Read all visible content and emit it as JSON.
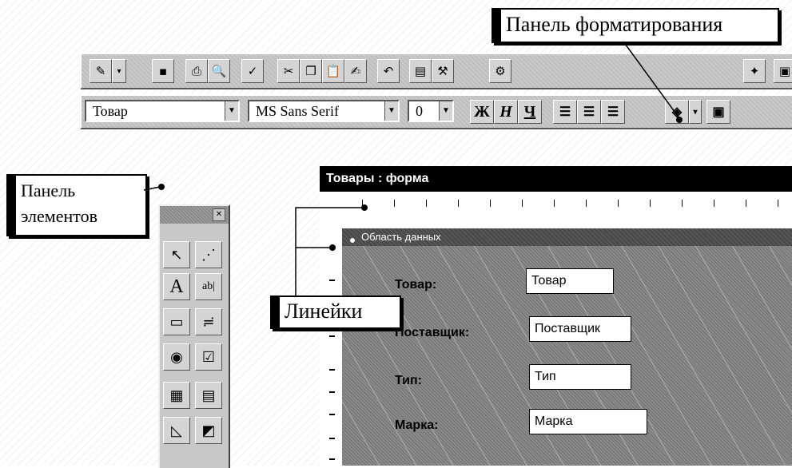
{
  "callouts": {
    "format_panel": "Панель форматирования",
    "toolbox_line1": "Панель",
    "toolbox_line2": "элементов",
    "rulers": "Линейки"
  },
  "format_toolbar": {
    "object_combo": "Товар",
    "font_combo": "MS Sans Serif",
    "size_combo": "0",
    "bold": "Ж",
    "italic": "Н",
    "underline": "Ч"
  },
  "form": {
    "title": "Товары : форма",
    "section": "Область данных",
    "fields": [
      {
        "label": "Товар:",
        "value": "Товар"
      },
      {
        "label": "Поставщик:",
        "value": "Поставщик"
      },
      {
        "label": "Тип:",
        "value": "Тип"
      },
      {
        "label": "Марка:",
        "value": "Марка"
      }
    ]
  },
  "toolbox": {
    "tools": [
      "pointer-icon",
      "wizard-icon",
      "label-tool-icon",
      "textbox-tool-icon",
      "frame-icon",
      "toggle-icon",
      "option-icon",
      "checkbox-icon",
      "combo-icon",
      "list-icon",
      "image-icon",
      "object-icon"
    ]
  },
  "colors": {
    "toolbar_bg": "#c8c8c8",
    "form_title_bg": "#000000",
    "detail_bg": "#8a8a8a"
  }
}
